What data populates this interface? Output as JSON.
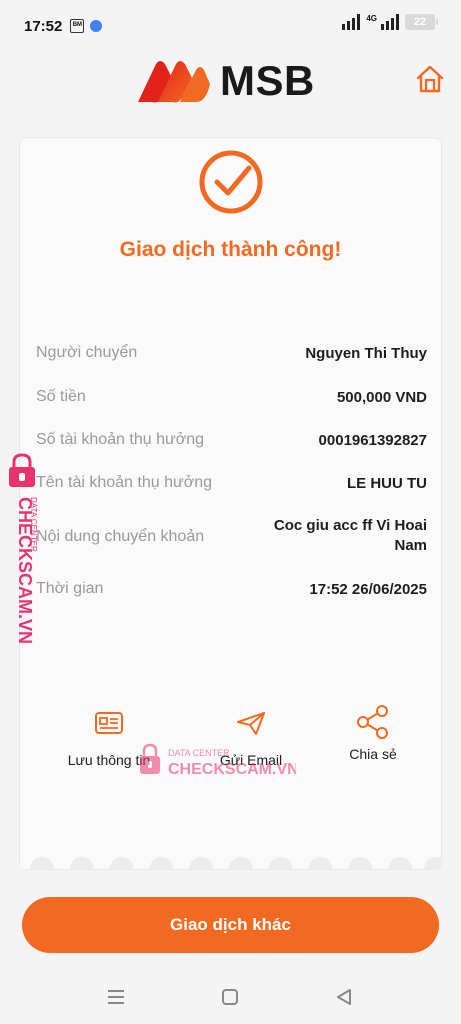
{
  "status_bar": {
    "time": "17:52",
    "app_badge": "BÁO MỚI",
    "network": "4G",
    "battery": "22"
  },
  "header": {
    "brand": "MSB",
    "home_icon": "home-icon"
  },
  "receipt": {
    "status_icon": "check-circle-icon",
    "title": "Giao dịch thành công!",
    "rows": [
      {
        "label": "Người chuyển",
        "value": "Nguyen Thi Thuy"
      },
      {
        "label": "Số tiền",
        "value": "500,000 VND"
      },
      {
        "label": "Số tài khoản thụ hưởng",
        "value": "0001961392827"
      },
      {
        "label": "Tên tài khoản thụ hưởng",
        "value": "LE HUU TU"
      },
      {
        "label": "Nội dung chuyển khoản",
        "value": "Coc giu acc ff Vi Hoai Nam"
      },
      {
        "label": "Thời gian",
        "value": "17:52 26/06/2025"
      }
    ],
    "actions": [
      {
        "label": "Lưu thông tin",
        "icon": "id-card-icon"
      },
      {
        "label": "Gửi Email",
        "icon": "paper-plane-icon"
      },
      {
        "label": "Chia sẻ",
        "icon": "share-icon"
      }
    ]
  },
  "watermark": {
    "side_text": "CHECKSCAM.VN",
    "side_sub": "DATA CENTER",
    "center_sub": "DATA CENTER",
    "center_text": "CHECKSCAM.VN"
  },
  "footer": {
    "primary_button": "Giao dịch khác"
  },
  "colors": {
    "accent": "#f26a21",
    "brand_red": "#e2231a",
    "watermark": "#e8336d"
  }
}
